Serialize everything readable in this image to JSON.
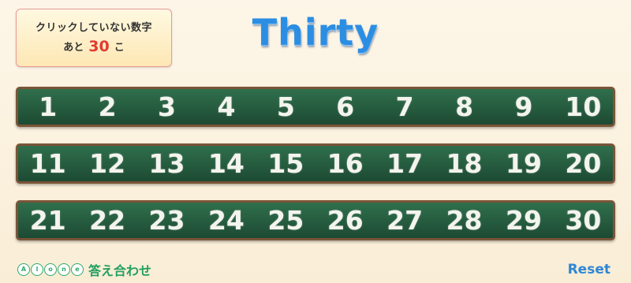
{
  "counter": {
    "label": "クリックしていない数字",
    "prefix": "あと",
    "count": "30",
    "suffix": "こ"
  },
  "title": "Thirty",
  "rows": [
    [
      "1",
      "2",
      "3",
      "4",
      "5",
      "6",
      "7",
      "8",
      "9",
      "10"
    ],
    [
      "11",
      "12",
      "13",
      "14",
      "15",
      "16",
      "17",
      "18",
      "19",
      "20"
    ],
    [
      "21",
      "22",
      "23",
      "24",
      "25",
      "26",
      "27",
      "28",
      "29",
      "30"
    ]
  ],
  "footer": {
    "logo_letters": [
      "A",
      "l",
      "o",
      "n",
      "e"
    ],
    "answer_label": "答え合わせ",
    "reset_label": "Reset"
  },
  "colors": {
    "title": "#2b8ee3",
    "board": "#245a3e",
    "board_border": "#7a5437",
    "count": "#e23b2e",
    "answer": "#22a060",
    "reset": "#2e87d6"
  }
}
